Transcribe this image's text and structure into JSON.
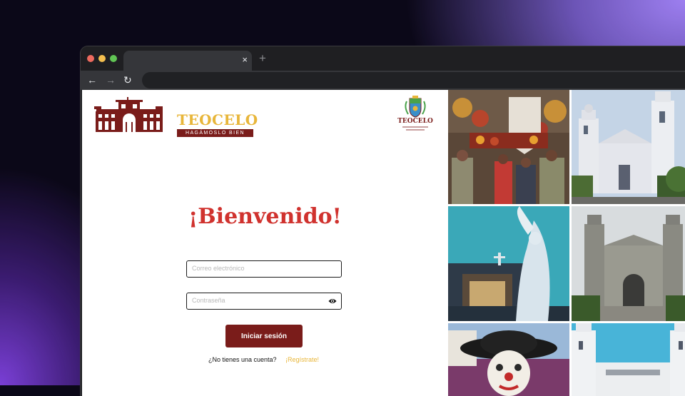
{
  "browser": {
    "tab_close": "×",
    "new_tab": "+",
    "back": "←",
    "forward": "→",
    "reload": "↻"
  },
  "header": {
    "brand": "TEOCELO",
    "slogan": "HAGÁMOSLO BIEN",
    "seal_brand": "TEOCELO"
  },
  "login": {
    "title": "¡Bienvenido!",
    "email_placeholder": "Correo electrónico",
    "password_placeholder": "Contraseña",
    "submit_label": "Iniciar sesión",
    "signup_question": "¿No tienes una cuenta?",
    "signup_link": "¡Regístrate!"
  },
  "colors": {
    "brand_maroon": "#7a1c1a",
    "brand_gold": "#e8b63a",
    "title_red": "#d0322e"
  },
  "icons": [
    "eye-icon",
    "back-arrow-icon",
    "forward-arrow-icon",
    "reload-icon",
    "close-icon",
    "plus-icon"
  ],
  "gallery": [
    "procession-photo",
    "church-white-facade-photo",
    "angel-statue-photo",
    "church-front-cloudy-photo",
    "clown-mask-photo",
    "church-blue-sky-photo"
  ]
}
